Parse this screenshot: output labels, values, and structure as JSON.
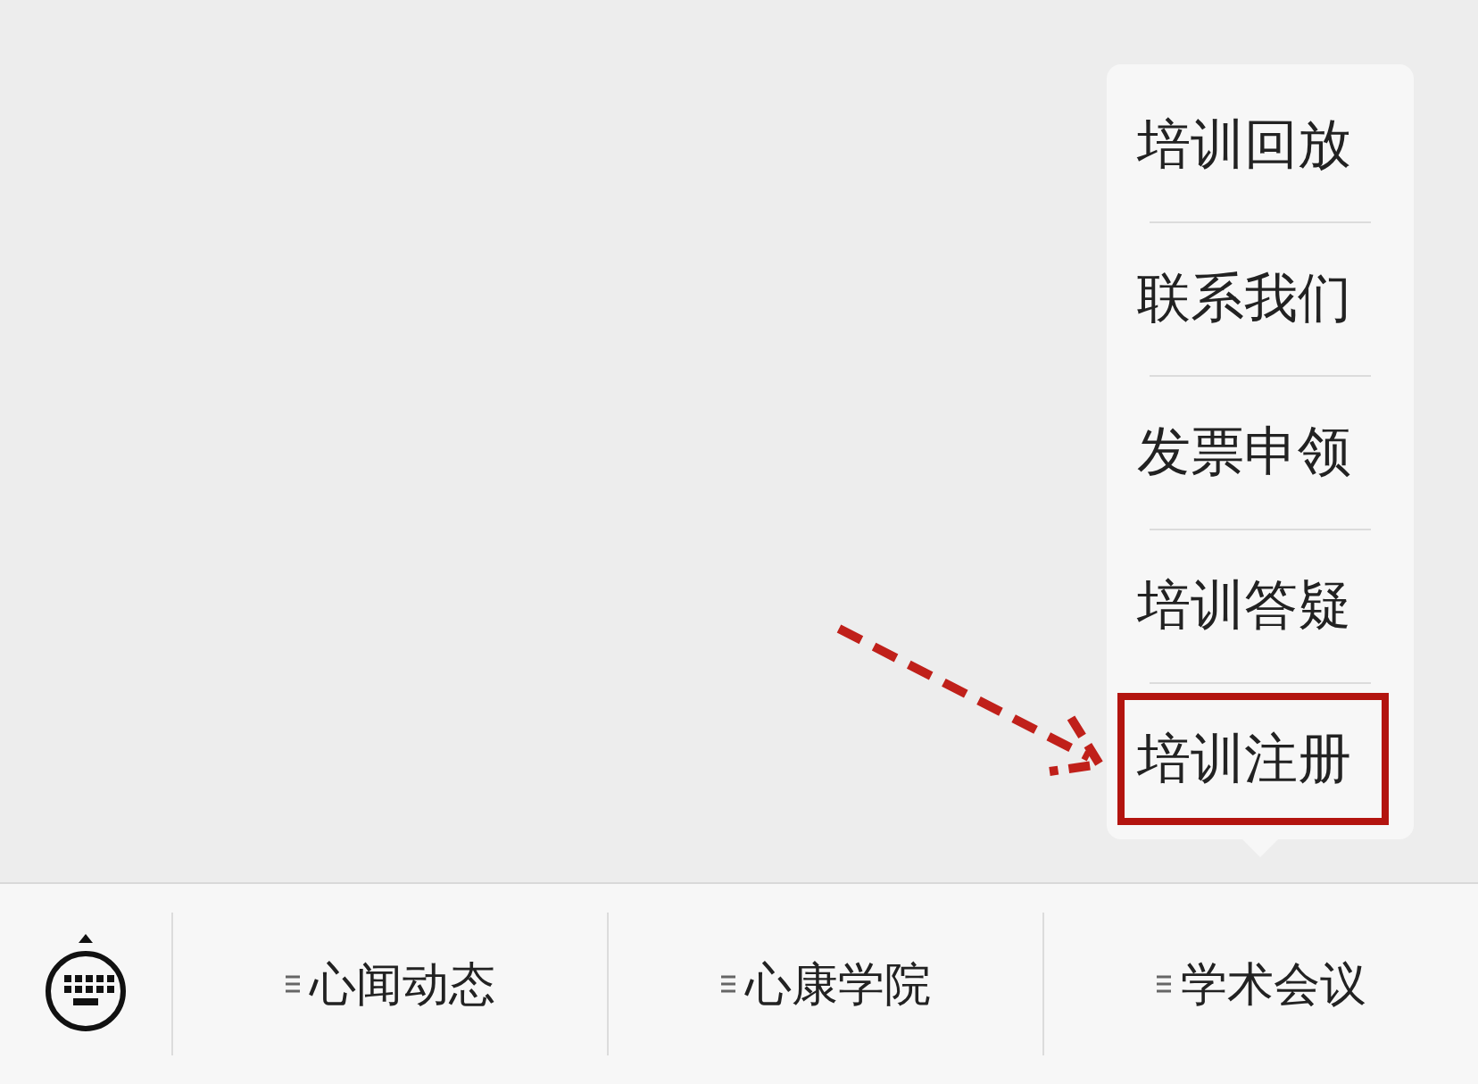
{
  "popup_menu": {
    "items": [
      {
        "label": "培训回放",
        "highlighted": false
      },
      {
        "label": "联系我们",
        "highlighted": false
      },
      {
        "label": "发票申领",
        "highlighted": false
      },
      {
        "label": "培训答疑",
        "highlighted": false
      },
      {
        "label": "培训注册",
        "highlighted": true
      }
    ]
  },
  "bottom_menu": {
    "items": [
      {
        "label": "心闻动态"
      },
      {
        "label": "心康学院"
      },
      {
        "label": "学术会议"
      }
    ]
  }
}
